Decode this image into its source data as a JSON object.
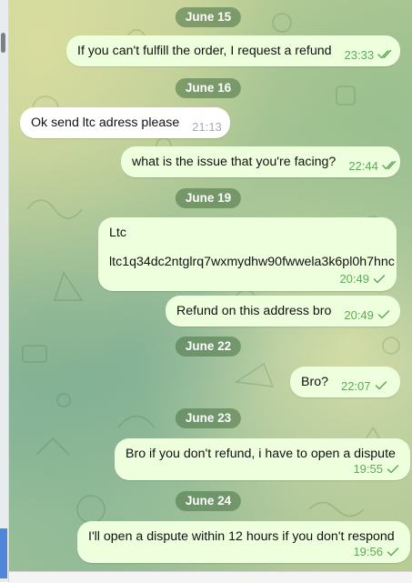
{
  "sidebar": {
    "scrollbar": "scroll-thumb",
    "accent_strip_color": "#4f86d9"
  },
  "chat": {
    "wallpaper_colors": [
      "#c9d49a",
      "#a6c495",
      "#8fb89a",
      "#b9cc97"
    ],
    "outgoing_bubble_color": "#eeffde",
    "incoming_bubble_color": "#ffffff",
    "date_pill_color": "#547a4e",
    "timeline": [
      {
        "type": "date",
        "label": "June 15"
      },
      {
        "type": "message",
        "direction": "outgoing",
        "text": "If you can't fulfill the order, I request a refund",
        "time": "23:33",
        "status": "read"
      },
      {
        "type": "date",
        "label": "June 16"
      },
      {
        "type": "message",
        "direction": "incoming",
        "text": "Ok send ltc adress please",
        "time": "21:13"
      },
      {
        "type": "message",
        "direction": "outgoing",
        "text": "what is the issue that you're facing?",
        "time": "22:44",
        "status": "read"
      },
      {
        "type": "date",
        "label": "June 19"
      },
      {
        "type": "message",
        "direction": "outgoing",
        "lines": [
          "Ltc",
          "",
          "ltc1q34dc2ntglrq7wxmydhw90fwwela3k6pl0h7hnc"
        ],
        "time": "20:49",
        "status": "sent"
      },
      {
        "type": "message",
        "direction": "outgoing",
        "text": "Refund on this address bro",
        "time": "20:49",
        "status": "sent"
      },
      {
        "type": "date",
        "label": "June 22"
      },
      {
        "type": "message",
        "direction": "outgoing",
        "text": "Bro?",
        "time": "22:07",
        "status": "sent"
      },
      {
        "type": "date",
        "label": "June 23"
      },
      {
        "type": "message",
        "direction": "outgoing",
        "text": "Bro if you don't refund, i have to open a dispute",
        "time": "19:55",
        "status": "sent"
      },
      {
        "type": "date",
        "label": "June 24"
      },
      {
        "type": "message",
        "direction": "outgoing",
        "text": "I'll open a dispute within 12 hours if you don't respond",
        "time": "19:56",
        "status": "sent"
      }
    ]
  }
}
